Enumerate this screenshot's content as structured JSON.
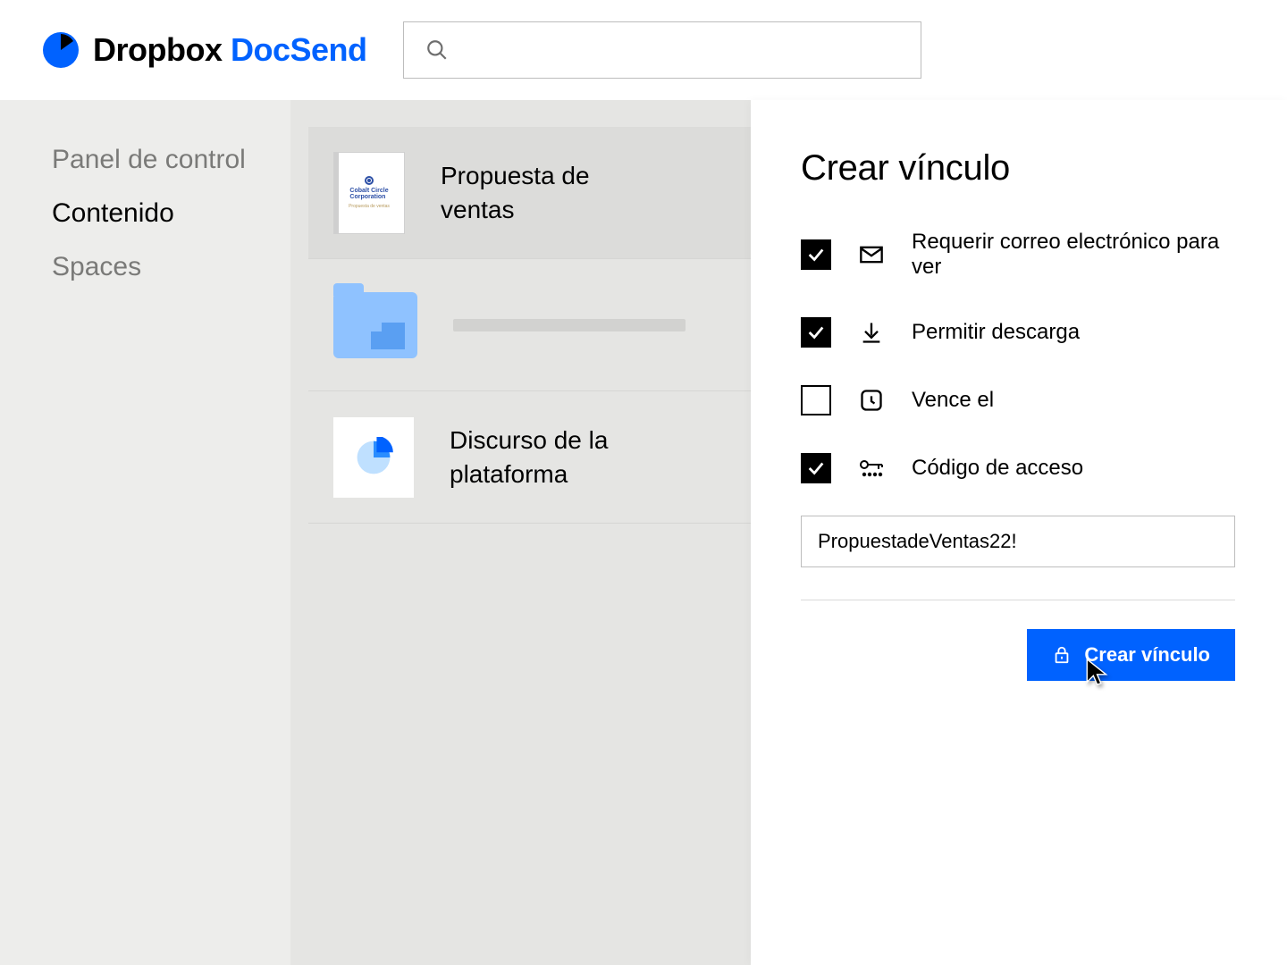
{
  "header": {
    "brand1": "Dropbox",
    "brand2": "DocSend",
    "search_placeholder": ""
  },
  "sidebar": {
    "items": [
      {
        "label": "Panel de control",
        "active": false
      },
      {
        "label": "Contenido",
        "active": true
      },
      {
        "label": "Spaces",
        "active": false
      }
    ]
  },
  "content": {
    "rows": [
      {
        "title": "Propuesta de ventas"
      },
      {
        "title": ""
      },
      {
        "title": "Discurso de la plataforma"
      }
    ]
  },
  "panel": {
    "title": "Crear vínculo",
    "options": [
      {
        "key": "email",
        "label": "Requerir correo electrónico para ver",
        "checked": true
      },
      {
        "key": "download",
        "label": "Permitir descarga",
        "checked": true
      },
      {
        "key": "expires",
        "label": "Vence el",
        "checked": false
      },
      {
        "key": "passcode",
        "label": "Código de acceso",
        "checked": true
      }
    ],
    "passcode_value": "PropuestadeVentas22!",
    "create_button": "Crear vínculo"
  },
  "colors": {
    "accent": "#0062ff"
  }
}
